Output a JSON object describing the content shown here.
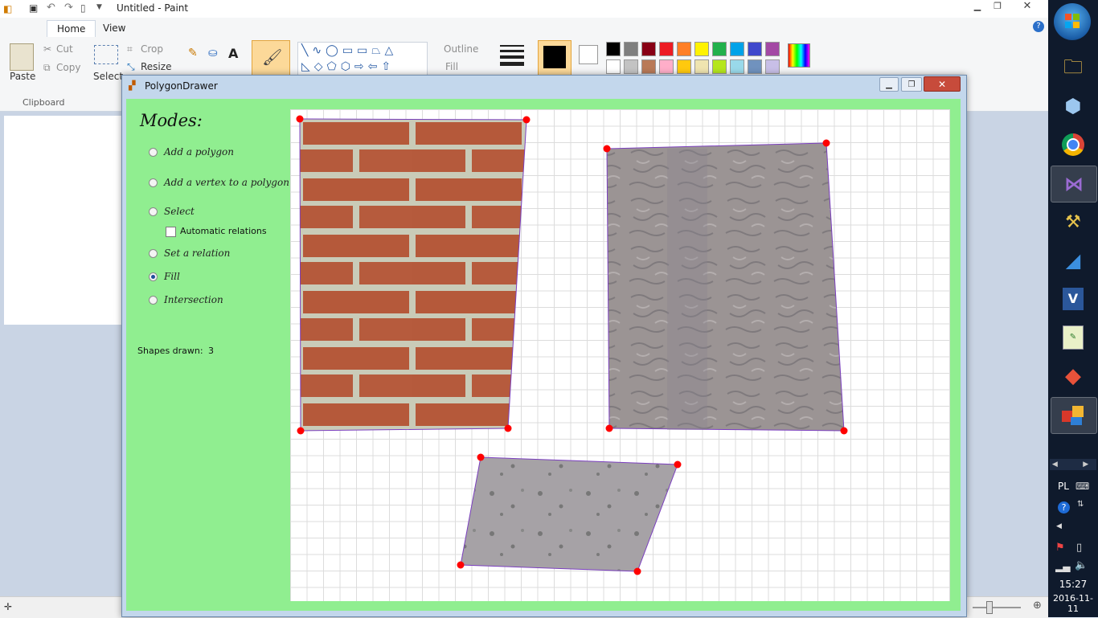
{
  "paint": {
    "title": "Untitled - Paint",
    "tabs": [
      "Home",
      "View"
    ],
    "clipboard": {
      "paste": "Paste",
      "cut": "Cut",
      "copy": "Copy",
      "group": "Clipboard"
    },
    "image": {
      "select": "Select",
      "crop": "Crop",
      "resize": "Resize"
    },
    "shapes": {
      "outline": "Outline",
      "fill": "Fill"
    },
    "palette_colors": [
      "#000000",
      "#7f7f7f",
      "#880015",
      "#ed1c24",
      "#ff7f27",
      "#fff200",
      "#22b14c",
      "#00a2e8",
      "#3f48cc",
      "#a349a4",
      "#ffffff",
      "#c3c3c3",
      "#b97a57",
      "#ffaec9",
      "#ffc90e",
      "#efe4b0",
      "#b5e61d",
      "#99d9ea",
      "#7092be",
      "#c8bfe7"
    ]
  },
  "polygon_drawer": {
    "title": "PolygonDrawer",
    "modes_heading": "Modes:",
    "modes": [
      {
        "label": "Add a polygon",
        "checked": false
      },
      {
        "label": "Add a vertex to a polygon",
        "checked": false
      },
      {
        "label": "Select",
        "checked": false
      },
      {
        "label": "Set a relation",
        "checked": false
      },
      {
        "label": "Fill",
        "checked": true
      },
      {
        "label": "Intersection",
        "checked": false
      }
    ],
    "automatic_relations": {
      "label": "Automatic relations",
      "checked": false
    },
    "shapes_drawn_label": "Shapes drawn:",
    "shapes_drawn_value": "3",
    "vertex_color": "#ff0000",
    "edge_color": "#7b3fbf"
  },
  "taskbar": {
    "language": "PL",
    "time": "15:27",
    "date": "2016-11-11"
  }
}
